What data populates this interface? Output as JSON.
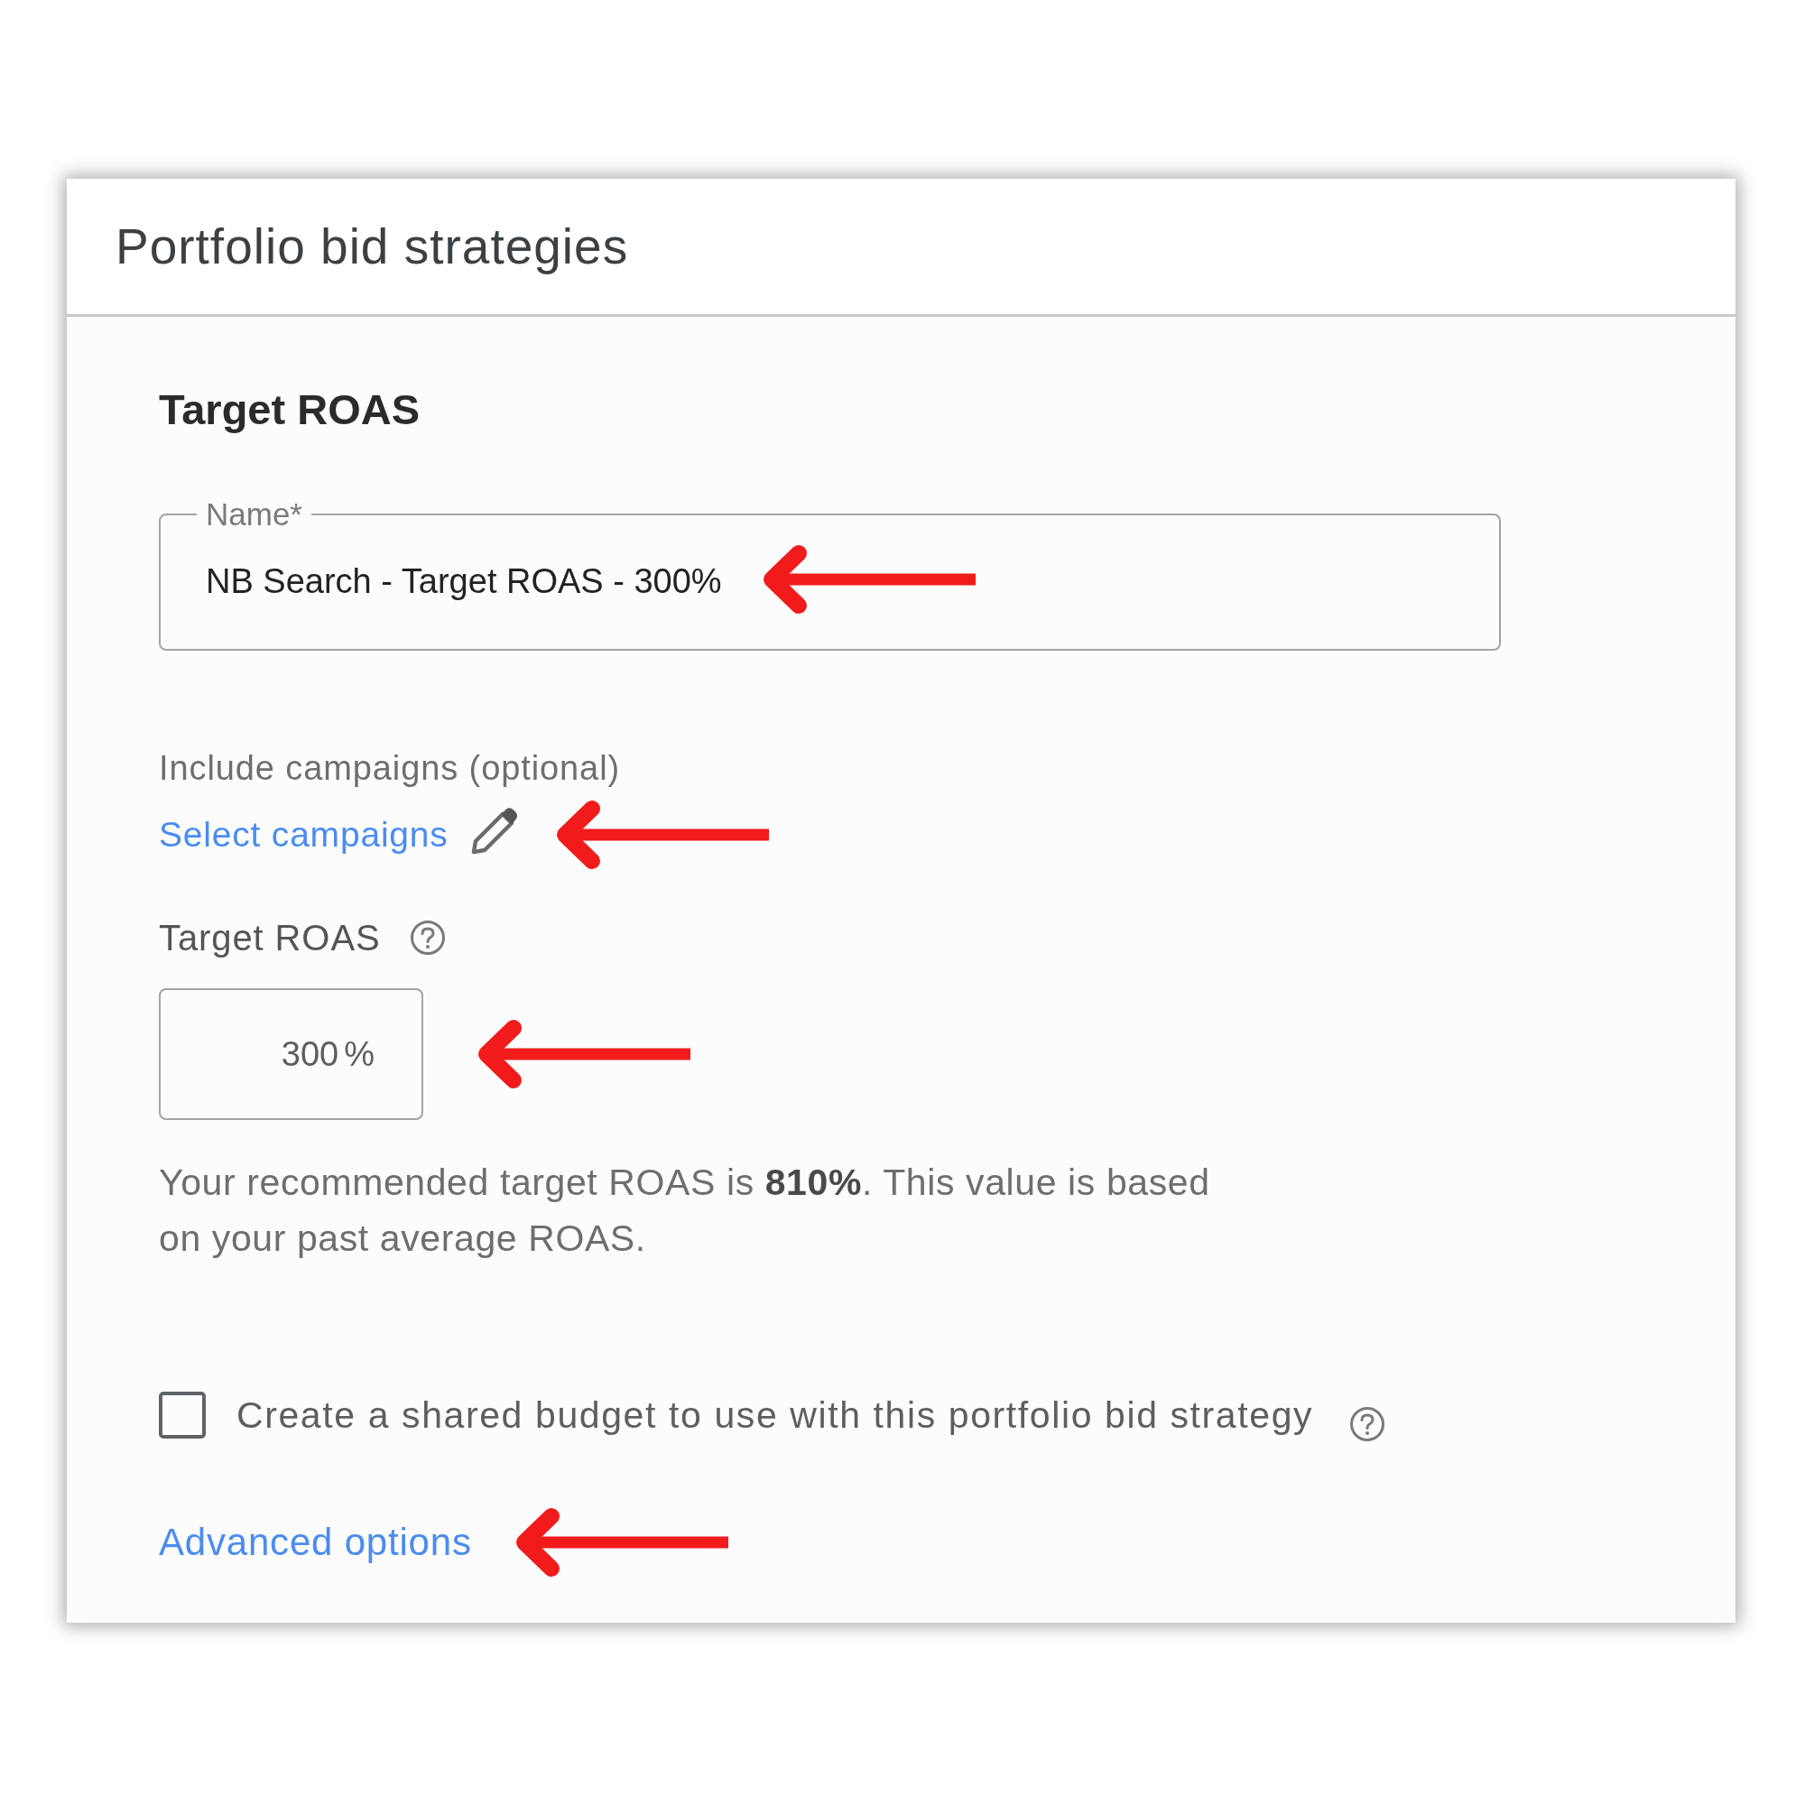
{
  "header": {
    "title": "Portfolio bid strategies"
  },
  "form": {
    "heading": "Target ROAS",
    "name_field": {
      "label": "Name*",
      "value": "NB Search - Target ROAS - 300%"
    },
    "campaigns": {
      "label": "Include campaigns (optional)",
      "link": "Select campaigns"
    },
    "target_roas": {
      "label": "Target ROAS",
      "value": "300",
      "suffix": "%"
    },
    "recommendation": "Your recommended target ROAS is **810%**. This value is based on your past average ROAS.",
    "shared_budget": {
      "label": "Create a shared budget to use with this portfolio bid strategy",
      "checked": false
    },
    "advanced_link": "Advanced options"
  }
}
